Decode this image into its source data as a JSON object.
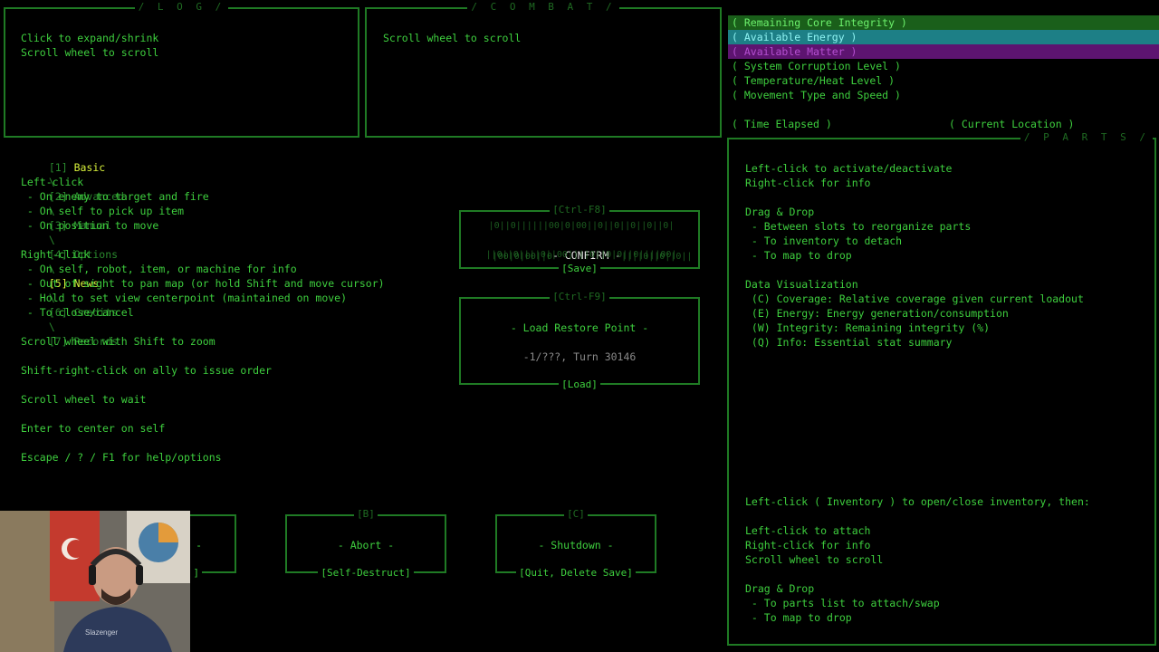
{
  "log": {
    "title": "/ L O G /",
    "lines": [
      "Click to expand/shrink",
      "Scroll wheel to scroll"
    ]
  },
  "combat": {
    "title": "/ C O M B A T /",
    "lines": [
      "Scroll wheel to scroll"
    ]
  },
  "stats": {
    "core": "( Remaining Core Integrity )",
    "energy": "( Available Energy )",
    "matter": "( Available Matter )",
    "corruption": "( System Corruption Level )",
    "heat": "( Temperature/Heat Level )",
    "movement": "( Movement Type and Speed )",
    "time": "( Time Elapsed )",
    "location": "( Current Location )",
    "colors": {
      "core": "#1d6b1d",
      "energy": "#1f8f8f",
      "matter": "#6b1a7a"
    }
  },
  "tabs": {
    "sep": "\\",
    "items": [
      {
        "key": "[1]",
        "label": "Basic"
      },
      {
        "key": "[2]",
        "label": "Advanced"
      },
      {
        "key": "[3]",
        "label": "Manual"
      },
      {
        "key": "[4]",
        "label": "Options"
      },
      {
        "key": "[5]",
        "label": "News"
      },
      {
        "key": "[6]",
        "label": "Credits"
      },
      {
        "key": "[7]",
        "label": "Records"
      }
    ]
  },
  "help": [
    "Left-click",
    " - On enemy to target and fire",
    " - On self to pick up item",
    " - On position to move",
    "",
    "Right-click",
    " - On self, robot, item, or machine for info",
    " - Out of sight to pan map (or hold Shift and move cursor)",
    " - Hold to set view centerpoint (maintained on move)",
    " - To close/cancel",
    "",
    "Scroll wheel with Shift to zoom",
    "",
    "Shift-right-click on ally to issue order",
    "",
    "Scroll wheel to wait",
    "",
    "Enter to center on self",
    "",
    "Escape / ? / F1 for help/options"
  ],
  "save_box": {
    "top": "[Ctrl-F8]",
    "noise1": "|0||0||||||00|0|00||0||0||0||0||0|",
    "noise2a": "|00|0|00||0",
    "confirm": "- CONFIRM -",
    "noise2b": "||||0||0||0||",
    "noise3": "||0||0||||0||00||||0||0|0||0||||00|",
    "bottom": "[Save]"
  },
  "load_box": {
    "top": "[Ctrl-F9]",
    "title": "- Load Restore Point -",
    "info": "-1/???, Turn 30146",
    "bottom": "[Load]"
  },
  "bottom_buttons": {
    "partial_label": "-",
    "partial_bottom": "]",
    "abort_top": "[B]",
    "abort": "- Abort -",
    "abort_bottom": "[Self-Destruct]",
    "shutdown_top": "[C]",
    "shutdown": "- Shutdown -",
    "shutdown_bottom": "[Quit, Delete Save]"
  },
  "parts": {
    "title": "/ P A R T S /",
    "lines": [
      "Left-click to activate/deactivate",
      "Right-click for info",
      "",
      "Drag & Drop",
      " - Between slots to reorganize parts",
      " - To inventory to detach",
      " - To map to drop",
      "",
      "Data Visualization",
      " (C) Coverage: Relative coverage given current loadout",
      " (E) Energy: Energy generation/consumption",
      " (W) Integrity: Remaining integrity (%)",
      " (Q) Info: Essential stat summary"
    ],
    "inventory_lines": [
      "Left-click ( Inventory ) to open/close inventory, then:",
      "",
      "Left-click to attach",
      "Right-click for info",
      "Scroll wheel to scroll",
      "",
      "Drag & Drop",
      " - To parts list to attach/swap",
      " - To map to drop"
    ]
  },
  "webcam": {
    "shirt_text": "Slazenger"
  }
}
